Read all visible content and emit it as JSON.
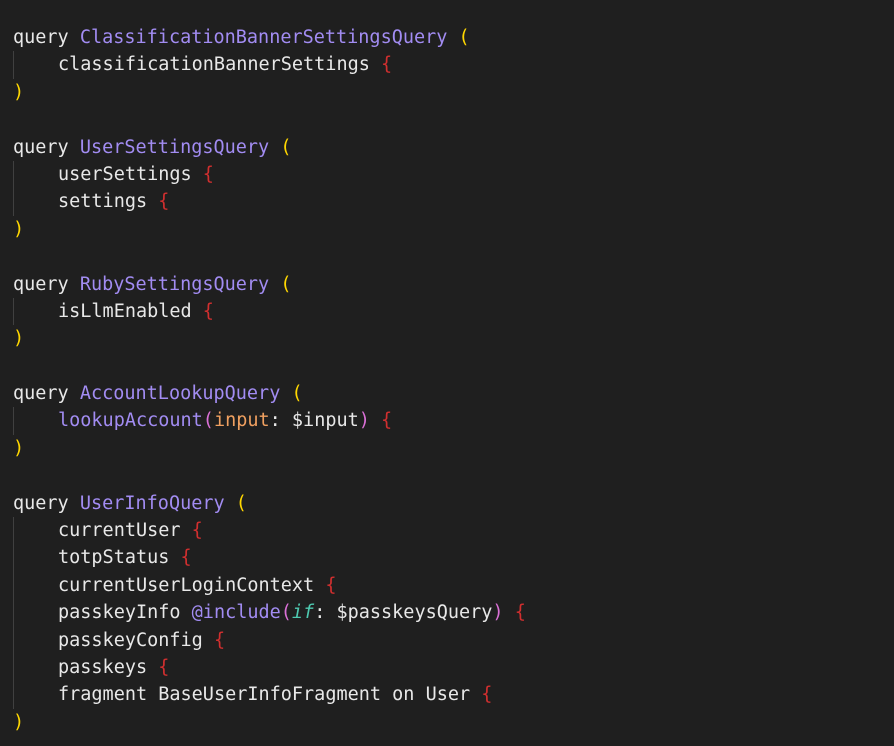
{
  "colors": {
    "background": "#1f1f1f",
    "keyword": "#e8e8e8",
    "type_name": "#a28cf2",
    "paren": "#ffd700",
    "brace": "#d12f2f",
    "arg_paren": "#da70d6",
    "arg": "#f0a060",
    "directive_arg": "#4ec9b0",
    "indent_guide": "#404040"
  },
  "code": {
    "q1": {
      "keyword": "query",
      "name": "ClassificationBannerSettingsQuery",
      "open": "(",
      "fields": [
        {
          "name": "classificationBannerSettings",
          "brace": "{"
        }
      ],
      "close": ")"
    },
    "q2": {
      "keyword": "query",
      "name": "UserSettingsQuery",
      "open": "(",
      "fields": [
        {
          "name": "userSettings",
          "brace": "{"
        },
        {
          "name": "settings",
          "brace": "{"
        }
      ],
      "close": ")"
    },
    "q3": {
      "keyword": "query",
      "name": "RubySettingsQuery",
      "open": "(",
      "fields": [
        {
          "name": "isLlmEnabled",
          "brace": "{"
        }
      ],
      "close": ")"
    },
    "q4": {
      "keyword": "query",
      "name": "AccountLookupQuery",
      "open": "(",
      "field": {
        "name": "lookupAccount",
        "arg_open": "(",
        "arg_name": "input",
        "colon": ": ",
        "arg_value": "$input",
        "arg_close": ")",
        "brace": "{"
      },
      "close": ")"
    },
    "q5": {
      "keyword": "query",
      "name": "UserInfoQuery",
      "open": "(",
      "fields": [
        {
          "name": "currentUser",
          "brace": "{"
        },
        {
          "name": "totpStatus",
          "brace": "{"
        },
        {
          "name": "currentUserLoginContext",
          "brace": "{"
        }
      ],
      "passkey_info": {
        "name": "passkeyInfo",
        "directive": "@include",
        "arg_open": "(",
        "arg_name": "if",
        "colon": ": ",
        "arg_value": "$passkeysQuery",
        "arg_close": ")",
        "brace": "{"
      },
      "fields_after": [
        {
          "name": "passkeyConfig",
          "brace": "{"
        },
        {
          "name": "passkeys",
          "brace": "{"
        }
      ],
      "fragment": {
        "keyword": "fragment",
        "name": "BaseUserInfoFragment",
        "on": "on",
        "type": "User",
        "brace": "{"
      },
      "close": ")"
    }
  }
}
